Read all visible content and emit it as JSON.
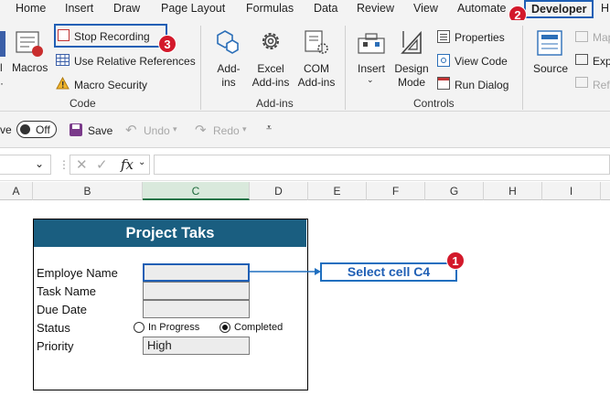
{
  "menu": {
    "tabs": [
      "Home",
      "Insert",
      "Draw",
      "Page Layout",
      "Formulas",
      "Data",
      "Review",
      "View",
      "Automate",
      "Developer",
      "H"
    ]
  },
  "ribbon": {
    "code": {
      "macros_cut": "l",
      "macros": "Macros",
      "stop_recording": "Stop Recording",
      "use_relative_references": "Use Relative References",
      "macro_security": "Macro Security",
      "group_label": "Code"
    },
    "addins": {
      "addins": "Add-\nins",
      "excel_addins": "Excel\nAdd-ins",
      "com_addins": "COM\nAdd-ins",
      "group_label": "Add-ins"
    },
    "controls": {
      "insert": "Insert",
      "design_mode": "Design\nMode",
      "properties": "Properties",
      "view_code": "View Code",
      "run_dialog": "Run Dialog",
      "group_label": "Controls"
    },
    "xml": {
      "source": "Source",
      "map": "Map",
      "expansion": "Exp",
      "refresh": "Refr"
    }
  },
  "qat": {
    "autosave_cut": "ve",
    "toggle_state": "Off",
    "save": "Save",
    "undo": "Undo",
    "redo": "Redo"
  },
  "formula_bar": {
    "fx": "fx",
    "cancel": "✕",
    "enter": "✓"
  },
  "columns": [
    "A",
    "B",
    "C",
    "D",
    "E",
    "F",
    "G",
    "H",
    "I"
  ],
  "form": {
    "title": "Project Taks",
    "labels": [
      "Employe  Name",
      "Task Name",
      "Due Date",
      "Status",
      "Priority"
    ],
    "priority_value": "High",
    "status_options": [
      "In Progress",
      "Completed"
    ],
    "status_selected": "Completed"
  },
  "callout": {
    "text": "Select cell C4"
  },
  "badges": [
    "1",
    "2",
    "3"
  ],
  "colors": {
    "accent_blue": "#1f5fb5",
    "badge_red": "#d3192b",
    "form_header": "#1a5e80",
    "excel_green": "#217346"
  }
}
